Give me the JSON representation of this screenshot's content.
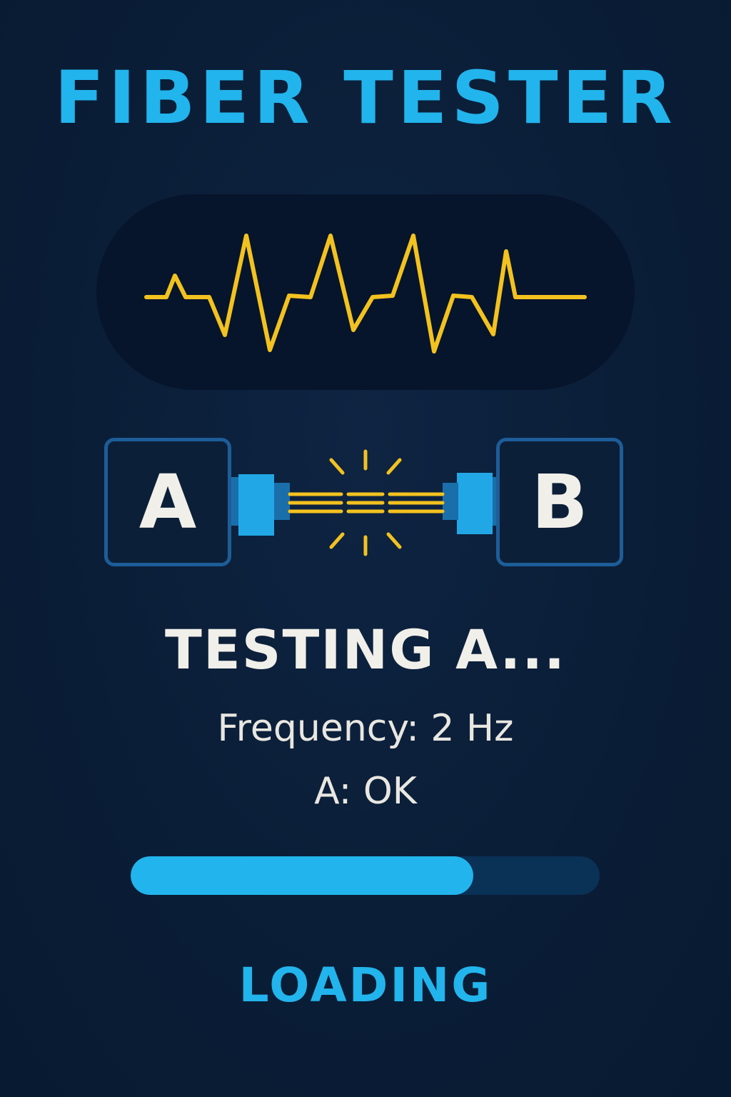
{
  "app": {
    "title": "FIBER TESTER"
  },
  "waveform": {
    "color": "#f3c21f",
    "panel_color": "#06152b"
  },
  "ports": {
    "left_label": "A",
    "right_label": "B",
    "plug_color": "#22a7e6",
    "fiber_color": "#f3c21f"
  },
  "status": {
    "heading": "TESTING A...",
    "frequency": "Frequency: 2 Hz",
    "result": "A: OK"
  },
  "progress": {
    "fraction": 0.73,
    "fill_color": "#22b4ec",
    "track_color": "#0a3156"
  },
  "footer": {
    "label": "LOADING"
  }
}
